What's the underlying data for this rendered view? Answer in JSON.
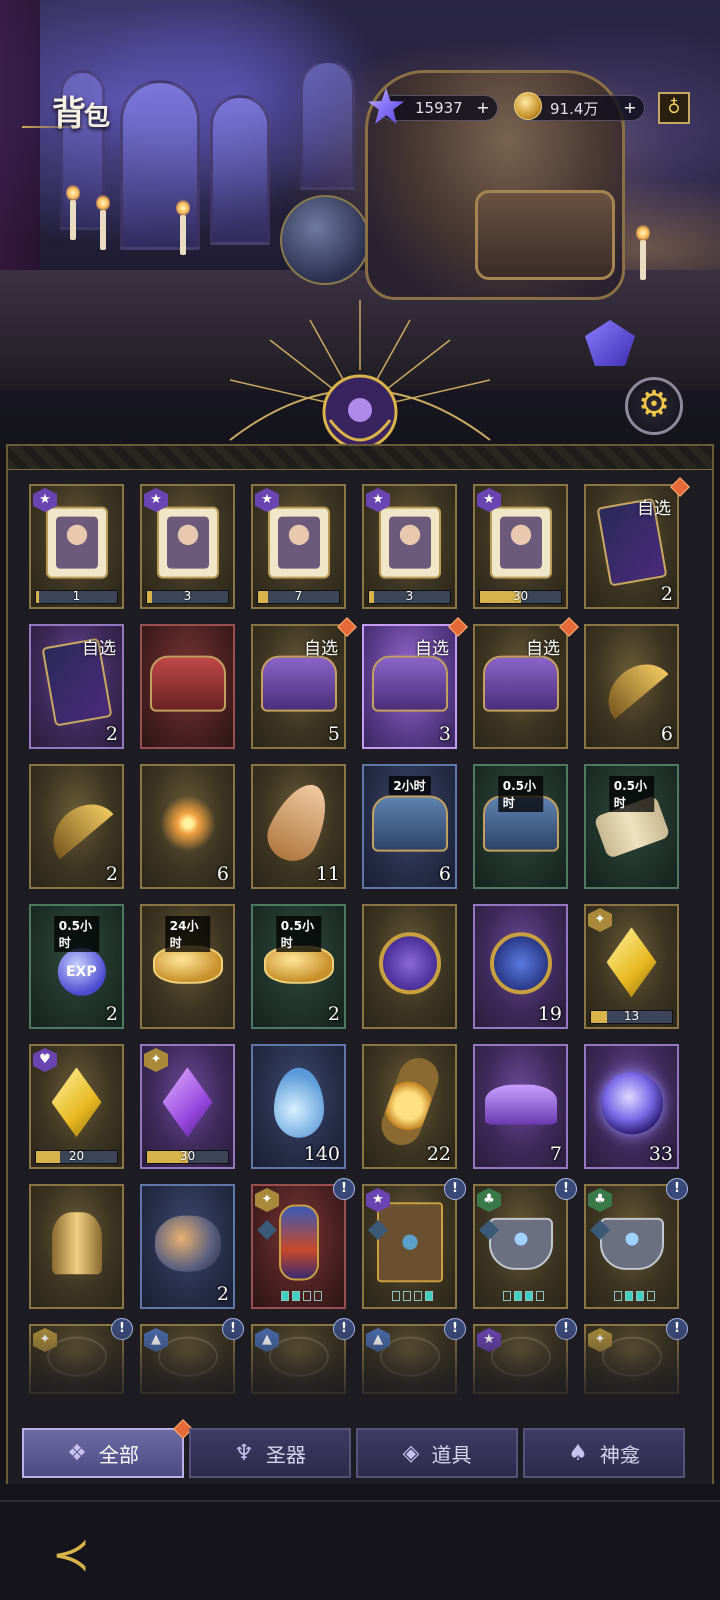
{
  "header": {
    "title_big": "背",
    "title_small": "包",
    "currency": [
      {
        "icon": "star-gem-icon",
        "value": "15937",
        "plus": "+"
      },
      {
        "icon": "gold-coin-icon",
        "value": "91.4万",
        "plus": "+"
      }
    ],
    "shop_icon": "money-bag-icon",
    "settings_icon": "gear-icon"
  },
  "inventory": {
    "rows": [
      [
        {
          "art": "puzzle",
          "bg": "gold",
          "rarity": "★",
          "progress": {
            "fill": 0.04,
            "text": "1"
          }
        },
        {
          "art": "puzzle",
          "bg": "gold",
          "rarity": "★",
          "progress": {
            "fill": 0.06,
            "text": "3"
          }
        },
        {
          "art": "puzzle",
          "bg": "gold",
          "rarity": "★",
          "progress": {
            "fill": 0.12,
            "text": "7"
          }
        },
        {
          "art": "puzzle",
          "bg": "gold",
          "rarity": "★",
          "progress": {
            "fill": 0.06,
            "text": "3"
          }
        },
        {
          "art": "puzzle",
          "bg": "gold",
          "rarity": "★",
          "progress": {
            "fill": 0.5,
            "text": "30"
          }
        },
        {
          "art": "card",
          "bg": "gold",
          "tag": "自选",
          "count": "2",
          "badge": "dot"
        }
      ],
      [
        {
          "art": "card",
          "bg": "purple",
          "tag": "自选",
          "count": "2"
        },
        {
          "art": "chest-red",
          "bg": "red"
        },
        {
          "art": "chest-violet",
          "bg": "gold",
          "tag": "自选",
          "count": "5",
          "badge": "dot"
        },
        {
          "art": "chest-violet",
          "bg": "selected",
          "tag": "自选",
          "count": "3",
          "badge": "dot"
        },
        {
          "art": "chest-violet",
          "bg": "gold",
          "tag": "自选",
          "count": "",
          "badge": "dot"
        },
        {
          "art": "feather",
          "bg": "gold",
          "count": "6"
        }
      ],
      [
        {
          "art": "feather",
          "bg": "gold",
          "count": "2"
        },
        {
          "art": "spark",
          "bg": "gold",
          "count": "6"
        },
        {
          "art": "shell",
          "bg": "gold",
          "count": "11"
        },
        {
          "art": "chest-blue",
          "bg": "blue",
          "time": "2小时",
          "count": "6"
        },
        {
          "art": "chest-blue",
          "bg": "green",
          "time": "0.5小时",
          "count": ""
        },
        {
          "art": "scroll",
          "bg": "green",
          "time": "0.5小时",
          "count": ""
        }
      ],
      [
        {
          "art": "exp",
          "bg": "green",
          "time": "0.5小时",
          "count": "2"
        },
        {
          "art": "coins",
          "bg": "gold",
          "time": "24小时",
          "count": ""
        },
        {
          "art": "coins",
          "bg": "green",
          "time": "0.5小时",
          "count": "2"
        },
        {
          "art": "disk-p",
          "bg": "gold",
          "count": ""
        },
        {
          "art": "disk-b",
          "bg": "purple",
          "count": "19"
        },
        {
          "art": "diamond-y",
          "bg": "gold",
          "rarity_gold": "✦",
          "progress": {
            "fill": 0.2,
            "text": "13"
          }
        }
      ],
      [
        {
          "art": "diamond-y",
          "bg": "gold",
          "rarity": "♥",
          "progress": {
            "fill": 0.3,
            "text": "20"
          }
        },
        {
          "art": "diamond-v",
          "bg": "purple",
          "rarity_gold": "✦",
          "progress": {
            "fill": 0.5,
            "text": "30"
          }
        },
        {
          "art": "drop",
          "bg": "blue",
          "count": "140"
        },
        {
          "art": "potion",
          "bg": "gold",
          "count": "22"
        },
        {
          "art": "crystals",
          "bg": "purple",
          "count": "7"
        },
        {
          "art": "orb",
          "bg": "purple",
          "count": "33"
        }
      ],
      [
        {
          "art": "bell",
          "bg": "gold",
          "count": ""
        },
        {
          "art": "jar",
          "bg": "blue",
          "count": "2"
        },
        {
          "art": "bottle",
          "bg": "red",
          "rarity_gold": "✦",
          "pips": [
            1,
            1,
            0,
            0
          ],
          "badge": "excl"
        },
        {
          "art": "book",
          "bg": "gold",
          "rarity": "★",
          "pips": [
            0,
            0,
            0,
            1
          ],
          "badge": "excl"
        },
        {
          "art": "cup",
          "bg": "gold",
          "rarity_green": "♣",
          "pips": [
            0,
            1,
            1,
            0
          ],
          "badge": "excl"
        },
        {
          "art": "cup",
          "bg": "gold",
          "rarity_green": "♣",
          "pips": [
            0,
            1,
            1,
            0
          ],
          "badge": "excl"
        }
      ],
      [
        {
          "art": "ghost",
          "bg": "gold",
          "rarity_gold": "✦",
          "badge": "excl"
        },
        {
          "art": "ghost",
          "bg": "gold",
          "rarity_blue": "▲",
          "badge": "excl"
        },
        {
          "art": "ghost",
          "bg": "gold",
          "rarity_blue": "▲",
          "badge": "excl"
        },
        {
          "art": "ghost",
          "bg": "gold",
          "rarity_blue": "▲",
          "badge": "excl"
        },
        {
          "art": "ghost",
          "bg": "gold",
          "rarity": "★",
          "badge": "excl"
        },
        {
          "art": "ghost",
          "bg": "gold",
          "rarity_gold": "✦",
          "badge": "excl"
        }
      ]
    ]
  },
  "tabs": [
    {
      "label": "全部",
      "icon": "grid-icon",
      "glyph": "❖",
      "active": true,
      "badge": true
    },
    {
      "label": "圣器",
      "icon": "chalice-icon",
      "glyph": "♆",
      "active": false,
      "badge": false
    },
    {
      "label": "道具",
      "icon": "ingots-icon",
      "glyph": "◈",
      "active": false,
      "badge": false
    },
    {
      "label": "神龛",
      "icon": "shrine-icon",
      "glyph": "♠",
      "active": false,
      "badge": false
    }
  ],
  "footer": {
    "back_icon": "back-arrow-icon",
    "back_glyph": "≺"
  },
  "excl_glyph": "!"
}
